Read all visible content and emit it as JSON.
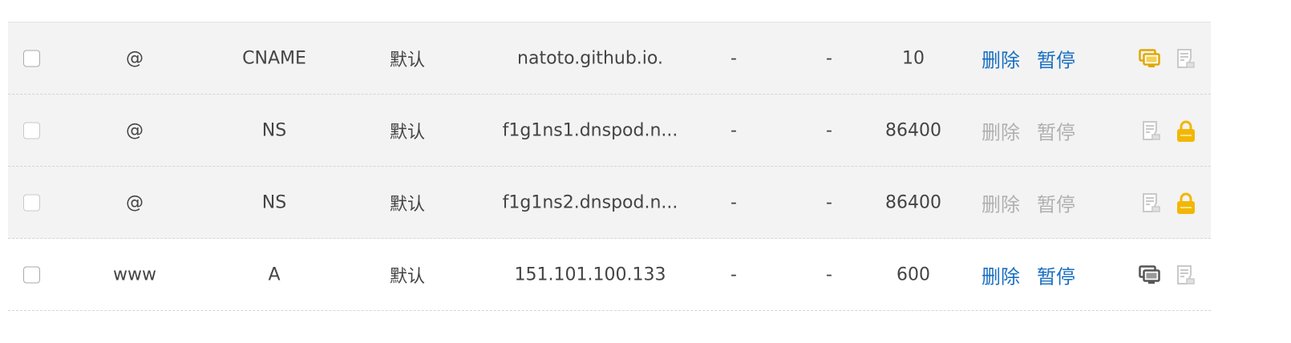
{
  "rows": [
    {
      "host": "@",
      "type": "CNAME",
      "line": "默认",
      "value": "natoto.github.io.",
      "mx": "-",
      "weight": "-",
      "ttl": "10",
      "delete_label": "删除",
      "pause_label": "暂停",
      "locked": false,
      "status_icon_color": "#e0a800"
    },
    {
      "host": "@",
      "type": "NS",
      "line": "默认",
      "value": "f1g1ns1.dnspod.n...",
      "mx": "-",
      "weight": "-",
      "ttl": "86400",
      "delete_label": "删除",
      "pause_label": "暂停",
      "locked": true
    },
    {
      "host": "@",
      "type": "NS",
      "line": "默认",
      "value": "f1g1ns2.dnspod.n...",
      "mx": "-",
      "weight": "-",
      "ttl": "86400",
      "delete_label": "删除",
      "pause_label": "暂停",
      "locked": true
    },
    {
      "host": "www",
      "type": "A",
      "line": "默认",
      "value": "151.101.100.133",
      "mx": "-",
      "weight": "-",
      "ttl": "600",
      "delete_label": "删除",
      "pause_label": "暂停",
      "locked": false,
      "status_icon_color": "#555555"
    }
  ],
  "colors": {
    "link": "#1a6fc0",
    "disabled": "#b0b0b0",
    "lock": "#f2b705",
    "row_highlight": "#f3f3f3"
  }
}
